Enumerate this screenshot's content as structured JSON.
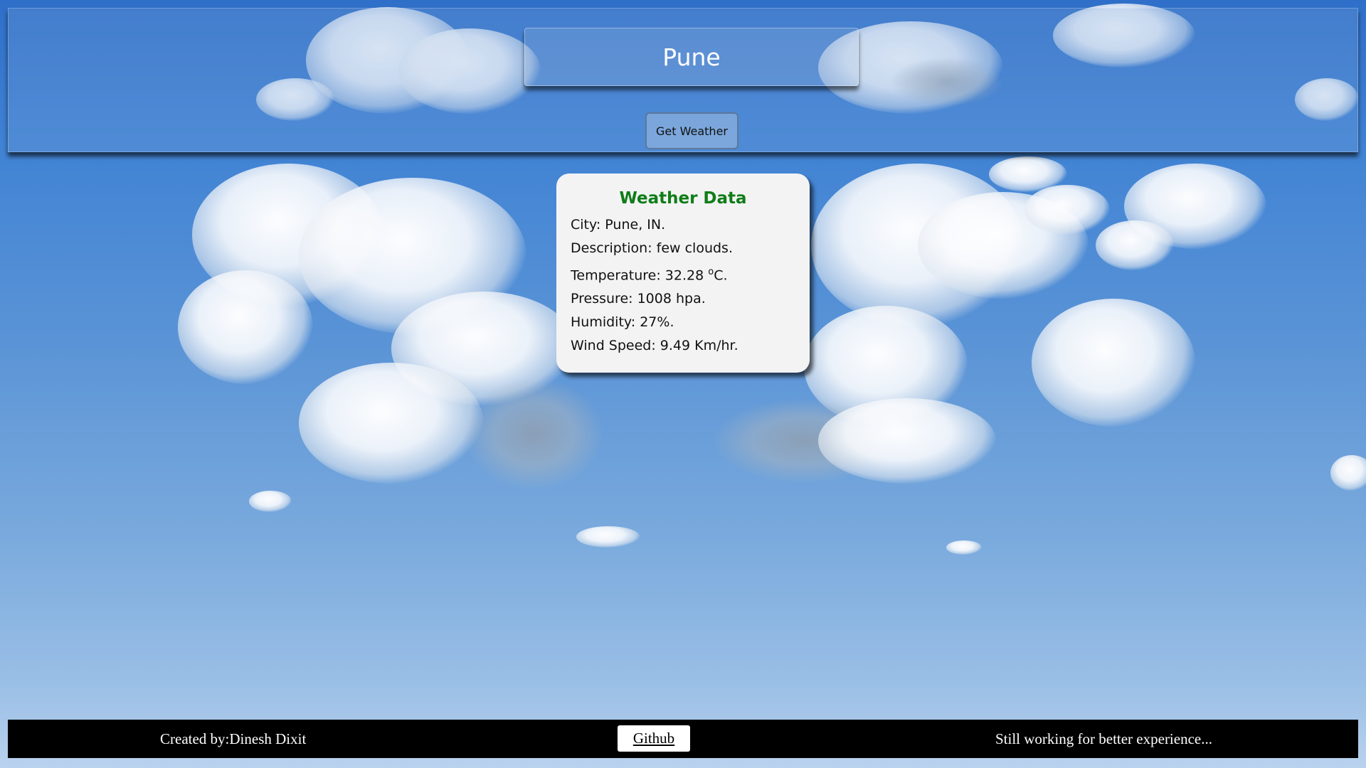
{
  "search": {
    "city_value": "Pune",
    "button_label": "Get Weather"
  },
  "weather": {
    "title": "Weather Data",
    "city": "City: Pune, IN.",
    "description": "Description: few clouds.",
    "temperature_prefix": "Temperature: 32.28 ",
    "temperature_degree": "o",
    "temperature_suffix": "C.",
    "pressure": "Pressure: 1008 hpa.",
    "humidity": "Humidity: 27%.",
    "wind_speed": "Wind Speed: 9.49 Km/hr."
  },
  "footer": {
    "credit": "Created by:Dinesh Dixit",
    "github_label": "Github",
    "note": "Still working for better experience..."
  },
  "colors": {
    "card_title": "#0f7d17",
    "footer_bg": "#000000",
    "sky": "#4a88d2"
  }
}
